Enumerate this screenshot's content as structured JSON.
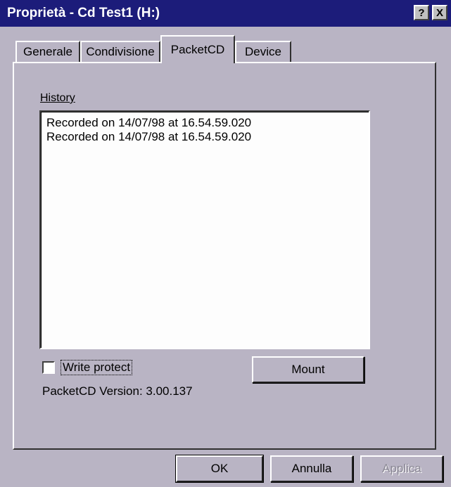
{
  "window": {
    "title": "Proprietà - Cd Test1 (H:)",
    "help_button": "?",
    "close_button": "X"
  },
  "tabs": [
    {
      "label": "Generale",
      "active": false
    },
    {
      "label": "Condivisione",
      "active": false
    },
    {
      "label": "PacketCD",
      "active": true
    },
    {
      "label": "Device",
      "active": false
    }
  ],
  "panel": {
    "history_label": "History",
    "history_items": [
      "Recorded on 14/07/98 at 16.54.59.020",
      "Recorded on 14/07/98 at 16.54.59.020"
    ],
    "write_protect_label": "Write protect",
    "write_protect_checked": false,
    "mount_button": "Mount",
    "version_text": "PacketCD Version: 3.00.137"
  },
  "footer": {
    "ok_button": "OK",
    "cancel_button": "Annulla",
    "apply_button": "Applica"
  },
  "colors": {
    "titlebar": "#1c1c7a",
    "face": "#b9b4c4",
    "listbox": "#fdfdfd"
  },
  "icons": [
    "help-icon",
    "close-icon"
  ]
}
